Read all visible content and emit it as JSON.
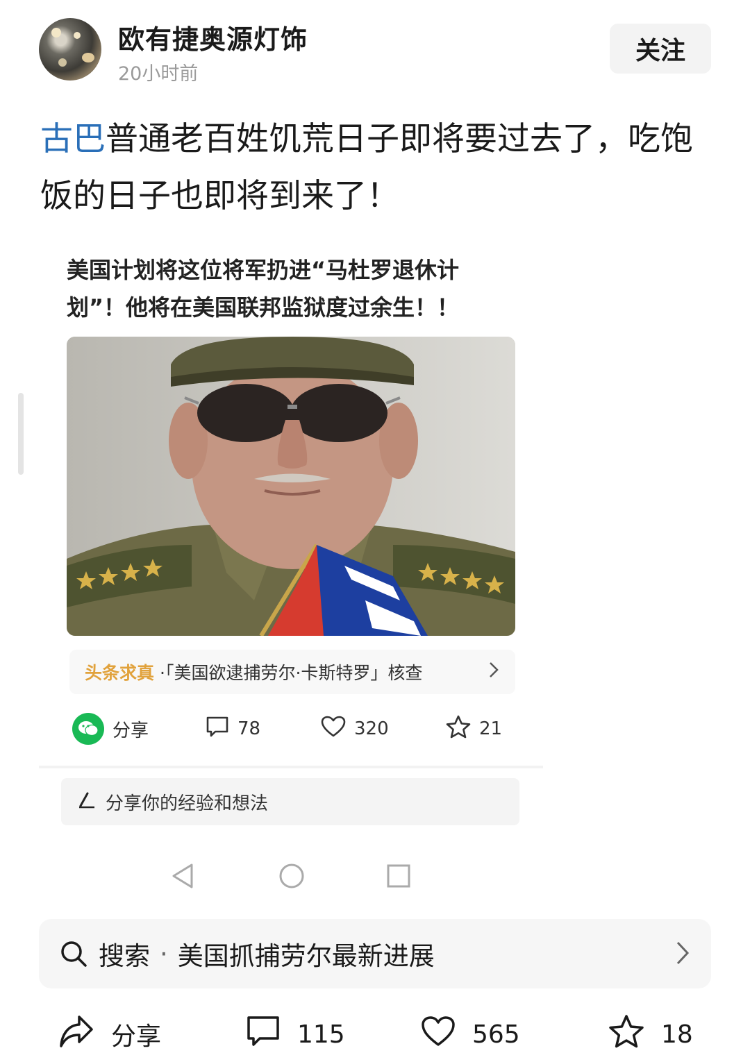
{
  "header": {
    "author_name": "欧有捷奥源灯饰",
    "post_time": "20小时前",
    "follow_label": "关注"
  },
  "post": {
    "topic": "古巴",
    "text": "普通老百姓饥荒日子即将要过去了，吃饱饭的日子也即将到来了！"
  },
  "embedded": {
    "title": "美国计划将这位将军扔进“马杜罗退休计划”！他将在美国联邦监狱度过余生！！",
    "factcheck_tag": "头条求真",
    "factcheck_text": "·「美国欲逮捕劳尔·卡斯特罗」核查",
    "actions": {
      "share_label": "分享",
      "comments": "78",
      "likes": "320",
      "favorites": "21"
    },
    "comment_placeholder": "分享你的经验和想法"
  },
  "search": {
    "prefix": "搜索",
    "separator": "·",
    "query": "美国抓捕劳尔最新进展"
  },
  "bottom": {
    "share_label": "分享",
    "comments": "115",
    "likes": "565",
    "favorites": "18"
  },
  "icons": {
    "share": "share-arrow-icon",
    "comment": "comment-bubble-icon",
    "like": "heart-icon",
    "favorite": "star-icon",
    "search": "search-icon",
    "wechat": "wechat-icon",
    "edit": "pencil-icon"
  },
  "colors": {
    "topic_link": "#2a6fb8",
    "factcheck_tag": "#e1a23c",
    "wechat_green": "#19b955"
  }
}
